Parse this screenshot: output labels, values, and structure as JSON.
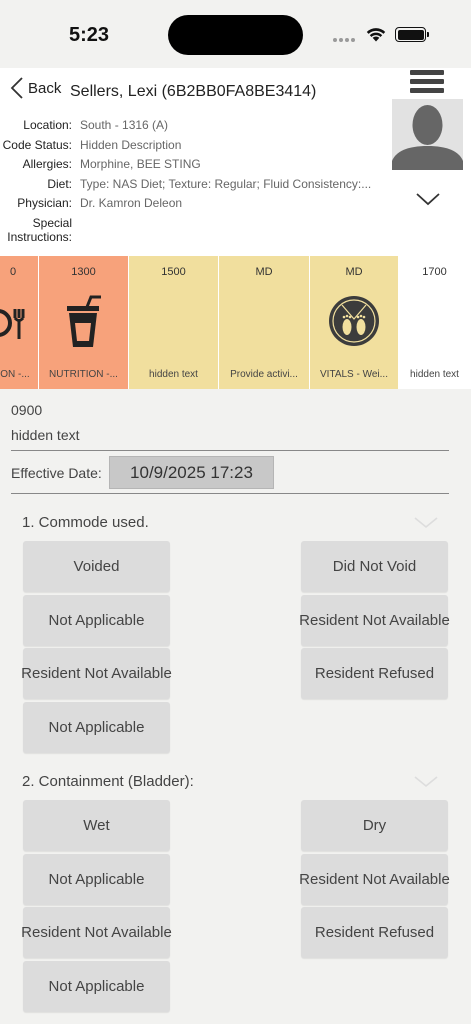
{
  "status_bar": {
    "time": "5:23"
  },
  "header": {
    "back_label": "Back",
    "patient_name": "Sellers, Lexi (6B2BB0FA8BE3414)",
    "info": [
      {
        "label": "Location:",
        "value": "South - 1316 (A)"
      },
      {
        "label": "Code Status:",
        "value": "Hidden Description"
      },
      {
        "label": "Allergies:",
        "value": "Morphine, BEE STING"
      },
      {
        "label": "Diet:",
        "value": "Type: NAS Diet; Texture: Regular; Fluid Consistency:..."
      },
      {
        "label": "Physician:",
        "value": "Dr. Kamron Deleon"
      },
      {
        "label": "Special Instructions:",
        "value": ""
      }
    ]
  },
  "tasks": [
    {
      "time": "0",
      "label": "ON -...",
      "color": "#f7a27b",
      "icon": "plate-utensils-icon"
    },
    {
      "time": "1300",
      "label": "NUTRITION -...",
      "color": "#f7a27b",
      "icon": "drink-cup-icon"
    },
    {
      "time": "1500",
      "label": "hidden text",
      "color": "#f1df9e",
      "icon": ""
    },
    {
      "time": "MD",
      "label": "Provide activi...",
      "color": "#f1df9e",
      "icon": ""
    },
    {
      "time": "MD",
      "label": "VITALS - Wei...",
      "color": "#f1df9e",
      "icon": "scale-footprints-icon"
    },
    {
      "time": "1700",
      "label": "hidden text",
      "color": "#ffffff",
      "icon": ""
    }
  ],
  "detail": {
    "time": "0900",
    "title": "hidden text",
    "effective_date_label": "Effective Date:",
    "effective_date_value": "10/9/2025 17:23"
  },
  "questions": [
    {
      "title": "1. Commode used.",
      "options_left": [
        "Voided",
        "Not Applicable",
        "Resident Not Available",
        "Not Applicable"
      ],
      "options_right": [
        "Did Not Void",
        "Resident Not Available",
        "Resident Refused"
      ]
    },
    {
      "title": "2. Containment (Bladder):",
      "options_left": [
        "Wet",
        "Not Applicable",
        "Resident Not Available",
        "Not Applicable"
      ],
      "options_right": [
        "Dry",
        "Resident Not Available",
        "Resident Refused"
      ]
    }
  ]
}
